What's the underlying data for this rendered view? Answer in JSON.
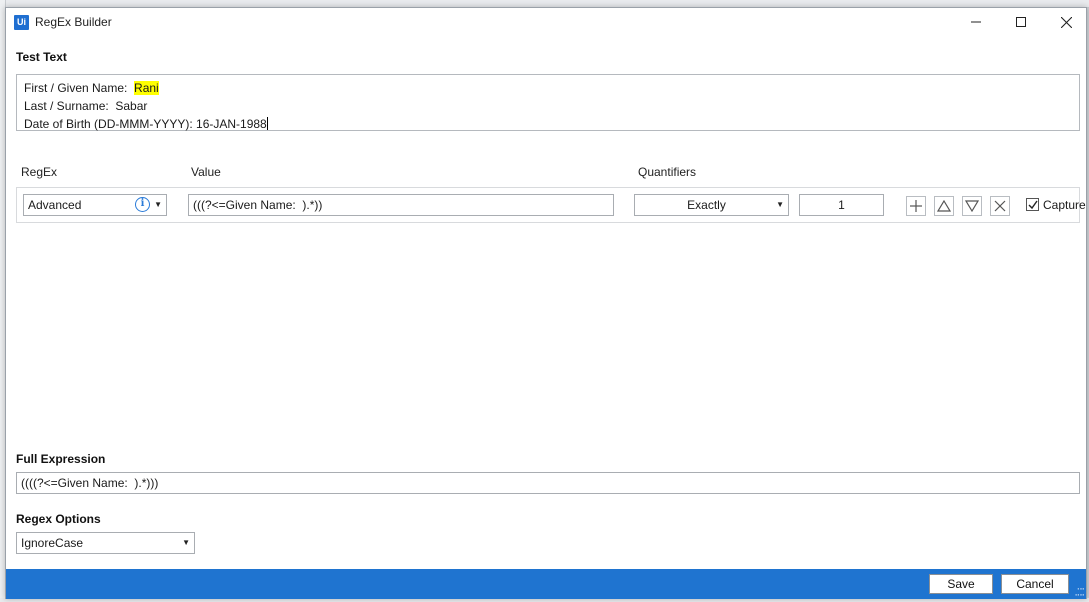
{
  "window": {
    "logo": "Ui",
    "title": "RegEx Builder",
    "minimize_icon": "minimize-icon",
    "maximize_icon": "maximize-icon",
    "close_icon": "close-icon"
  },
  "test_text": {
    "label": "Test Text",
    "line1_prefix": "First / Given Name:  ",
    "line1_match": "Rani",
    "line2": "Last / Surname:  Sabar",
    "line3": "Date of Birth (DD-MMM-YYYY): 16-JAN-1988",
    "highlight_color": "#ffff00"
  },
  "columns": {
    "regex": "RegEx",
    "value": "Value",
    "quantifiers": "Quantifiers"
  },
  "rule_row": {
    "regex_type": "Advanced",
    "value": "(((?<=Given Name:  ).*))",
    "quantifier": "Exactly",
    "quantity": "1",
    "capture_label": "Capture",
    "capture_checked": true,
    "icons": [
      "info-icon",
      "add-icon",
      "move-up-icon",
      "move-down-icon",
      "remove-icon"
    ]
  },
  "full_expression": {
    "label": "Full Expression",
    "value": "((((?<=Given Name:  ).*)))"
  },
  "regex_options": {
    "label": "Regex Options",
    "selected": "IgnoreCase"
  },
  "footer": {
    "save": "Save",
    "cancel": "Cancel",
    "bar_color": "#1f74d0"
  }
}
